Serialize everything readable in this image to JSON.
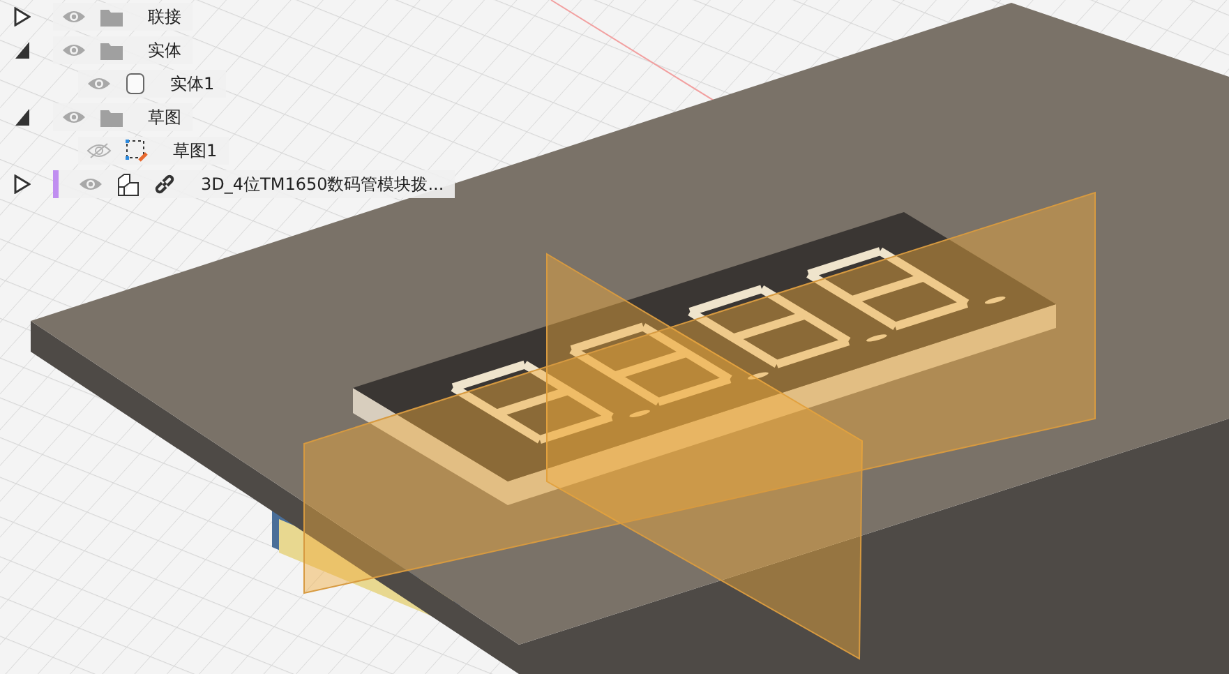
{
  "browser": {
    "items": [
      {
        "label": "联接",
        "kind": "folder",
        "expanded": false,
        "visible": true
      },
      {
        "label": "实体",
        "kind": "folder",
        "expanded": true,
        "visible": true,
        "children": [
          {
            "label": "实体1",
            "kind": "body",
            "visible": true
          }
        ]
      },
      {
        "label": "草图",
        "kind": "folder",
        "expanded": true,
        "visible": true,
        "children": [
          {
            "label": "草图1",
            "kind": "sketch",
            "visible": false
          }
        ]
      },
      {
        "label": "3D_4位TM1650数码管模块拨...",
        "kind": "component",
        "expanded": false,
        "visible": true,
        "linked": true
      }
    ]
  }
}
